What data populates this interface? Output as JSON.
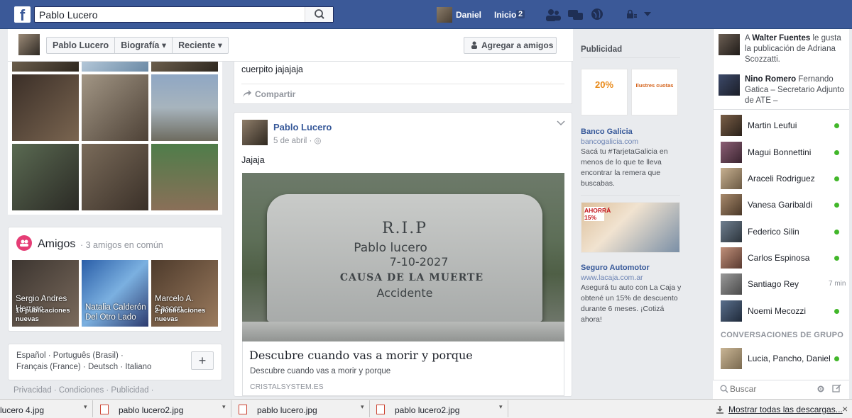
{
  "topbar": {
    "logo": "f",
    "search_value": "Pablo Lucero",
    "user_name": "Daniel",
    "home_label": "Inicio",
    "home_count": "2"
  },
  "profile": {
    "nav": [
      "Pablo Lucero",
      "Biografía ▾",
      "Reciente ▾"
    ],
    "add_friend": "Agregar a amigos"
  },
  "friends": {
    "title": "Amigos",
    "subtitle": "· 3 amigos en común",
    "items": [
      {
        "name": "Sergio Andres Herrero",
        "info": "10 publicaciones nuevas"
      },
      {
        "name": "Natalia Calderón Del Otro Lado",
        "info": ""
      },
      {
        "name": "Marcelo A. Cascon",
        "info": "2 publicaciones nuevas"
      }
    ]
  },
  "languages": {
    "line1": "Español · Português (Brasil) ·",
    "line2": "Français (France) · Deutsch · Italiano",
    "plus": "+"
  },
  "footer": "Privacidad · Condiciones · Publicidad ·",
  "post1": {
    "text": "cuerpito jajajaja",
    "share": "Compartir"
  },
  "post2": {
    "author": "Pablo Lucero",
    "date": "5 de abril · ◎",
    "text": "Jajaja",
    "tomb": {
      "rip": "R.I.P",
      "name": "Pablo lucero",
      "date": "7-10-2027",
      "cause": "CAUSA DE LA MUERTE",
      "reason": "Accidente"
    },
    "link_title": "Descubre cuando vas a morir y porque",
    "link_desc": "Descubre cuando vas a morir y porque",
    "link_domain": "CRISTALSYSTEM.ES"
  },
  "ads": {
    "title": "Publicidad",
    "items": [
      {
        "img_text_a": "20%",
        "img_text_b": "Ilustres cuotas",
        "name": "Banco Galicia",
        "url": "bancogalicia.com",
        "desc": "Sacá tu #TarjetaGalicia en menos de lo que te lleva encontrar la remera que buscabas."
      },
      {
        "img_text_a": "AHORRÁ 15%",
        "name": "Seguro Automotor",
        "url": "www.lacaja.com.ar",
        "desc": "Asegurá tu auto con La Caja y obtené un 15% de descuento durante 6 meses. ¡Cotizá ahora!"
      }
    ]
  },
  "ticker": [
    {
      "pre": "A ",
      "bold": "Walter Fuentes",
      "rest": " le gusta la publicación de Adriana Scozzatti."
    },
    {
      "pre": "",
      "bold": "Nino Romero",
      "rest": " Fernando Gatica – Secretario Adjunto de ATE –"
    }
  ],
  "chat": {
    "contacts": [
      {
        "name": "Martin Leufui",
        "status": "online"
      },
      {
        "name": "Magui Bonnettini",
        "status": "online"
      },
      {
        "name": "Araceli Rodriguez",
        "status": "online"
      },
      {
        "name": "Vanesa Garibaldi",
        "status": "online"
      },
      {
        "name": "Federico Silin",
        "status": "online"
      },
      {
        "name": "Carlos Espinosa",
        "status": "online"
      },
      {
        "name": "Santiago Rey",
        "status": "7 min"
      },
      {
        "name": "Noemi Mecozzi",
        "status": "online"
      }
    ],
    "group_title": "CONVERSACIONES DE GRUPO",
    "group": {
      "name": "Lucia, Pancho, Daniel",
      "status": "online"
    },
    "search_placeholder": "Buscar"
  },
  "downloads": {
    "items": [
      "lucero 4.jpg",
      "pablo lucero2.jpg",
      "pablo lucero.jpg",
      "pablo lucero2.jpg"
    ],
    "show_all": "Mostrar todas las descargas...",
    "close": "×"
  },
  "colors": {
    "brand": "#3b5998",
    "link": "#365899",
    "online": "#42b72a"
  }
}
